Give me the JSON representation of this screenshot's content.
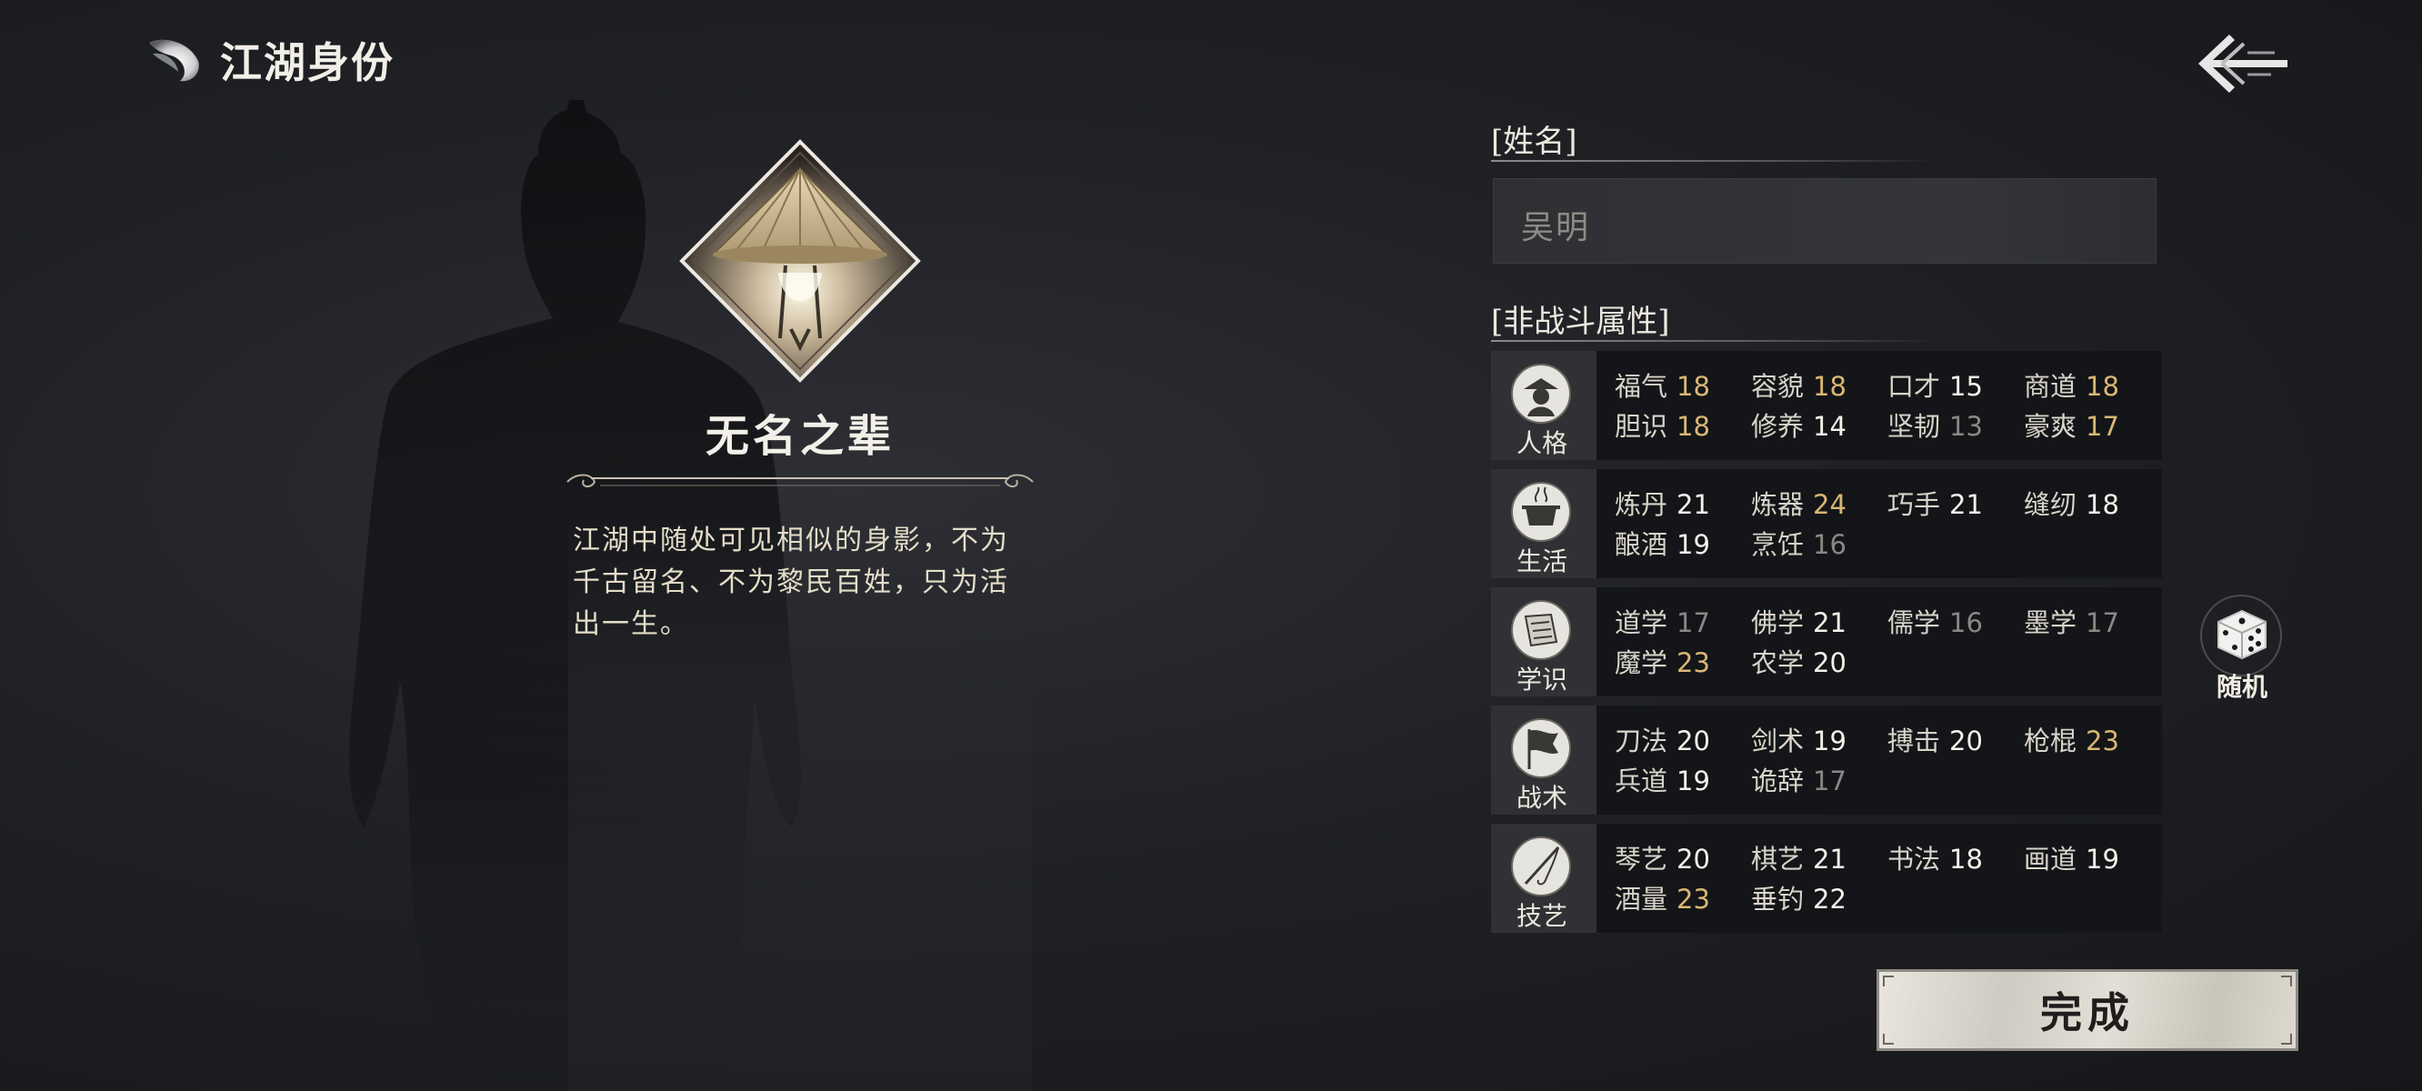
{
  "header": {
    "title": "江湖身份",
    "logo_icon": "swirl-logo-icon",
    "back_icon": "back-arrow-icon"
  },
  "identity": {
    "name": "无名之辈",
    "description": "江湖中随处可见相似的身影，不为\n千古留名、不为黎民百姓，只为活\n出一生。",
    "emblem_icon": "bamboo-hat-emblem-icon"
  },
  "name_section": {
    "label": "[姓名]",
    "value": "吴明"
  },
  "attributes_section": {
    "label": "[非战斗属性]",
    "categories": [
      {
        "label": "人格",
        "icon": "sage-portrait-icon",
        "stats": [
          {
            "name": "福气",
            "value": "18",
            "tone": "high"
          },
          {
            "name": "容貌",
            "value": "18",
            "tone": "high"
          },
          {
            "name": "口才",
            "value": "15",
            "tone": "normal"
          },
          {
            "name": "商道",
            "value": "18",
            "tone": "high"
          },
          {
            "name": "胆识",
            "value": "18",
            "tone": "high"
          },
          {
            "name": "修养",
            "value": "14",
            "tone": "normal"
          },
          {
            "name": "坚韧",
            "value": "13",
            "tone": "low"
          },
          {
            "name": "豪爽",
            "value": "17",
            "tone": "high"
          }
        ]
      },
      {
        "label": "生活",
        "icon": "cauldron-icon",
        "stats": [
          {
            "name": "炼丹",
            "value": "21",
            "tone": "normal"
          },
          {
            "name": "炼器",
            "value": "24",
            "tone": "high"
          },
          {
            "name": "巧手",
            "value": "21",
            "tone": "normal"
          },
          {
            "name": "缝纫",
            "value": "18",
            "tone": "normal"
          },
          {
            "name": "酿酒",
            "value": "19",
            "tone": "normal"
          },
          {
            "name": "烹饪",
            "value": "16",
            "tone": "low"
          }
        ]
      },
      {
        "label": "学识",
        "icon": "scroll-icon",
        "stats": [
          {
            "name": "道学",
            "value": "17",
            "tone": "low"
          },
          {
            "name": "佛学",
            "value": "21",
            "tone": "normal"
          },
          {
            "name": "儒学",
            "value": "16",
            "tone": "low"
          },
          {
            "name": "墨学",
            "value": "17",
            "tone": "low"
          },
          {
            "name": "魔学",
            "value": "23",
            "tone": "high"
          },
          {
            "name": "农学",
            "value": "20",
            "tone": "normal"
          }
        ]
      },
      {
        "label": "战术",
        "icon": "war-flag-icon",
        "stats": [
          {
            "name": "刀法",
            "value": "20",
            "tone": "normal"
          },
          {
            "name": "剑术",
            "value": "19",
            "tone": "normal"
          },
          {
            "name": "搏击",
            "value": "20",
            "tone": "normal"
          },
          {
            "name": "枪棍",
            "value": "23",
            "tone": "high"
          },
          {
            "name": "兵道",
            "value": "19",
            "tone": "normal"
          },
          {
            "name": "诡辞",
            "value": "17",
            "tone": "low"
          }
        ]
      },
      {
        "label": "技艺",
        "icon": "fishing-rod-icon",
        "stats": [
          {
            "name": "琴艺",
            "value": "20",
            "tone": "normal"
          },
          {
            "name": "棋艺",
            "value": "21",
            "tone": "normal"
          },
          {
            "name": "书法",
            "value": "18",
            "tone": "normal"
          },
          {
            "name": "画道",
            "value": "19",
            "tone": "normal"
          },
          {
            "name": "酒量",
            "value": "23",
            "tone": "high"
          },
          {
            "name": "垂钓",
            "value": "22",
            "tone": "normal"
          }
        ]
      }
    ]
  },
  "random_button": {
    "label": "随机",
    "icon": "dice-icon"
  },
  "done_button": {
    "label": "完成"
  },
  "colors": {
    "high": "#d9b774",
    "normal": "#f4f1ea",
    "low": "#8a8884"
  }
}
